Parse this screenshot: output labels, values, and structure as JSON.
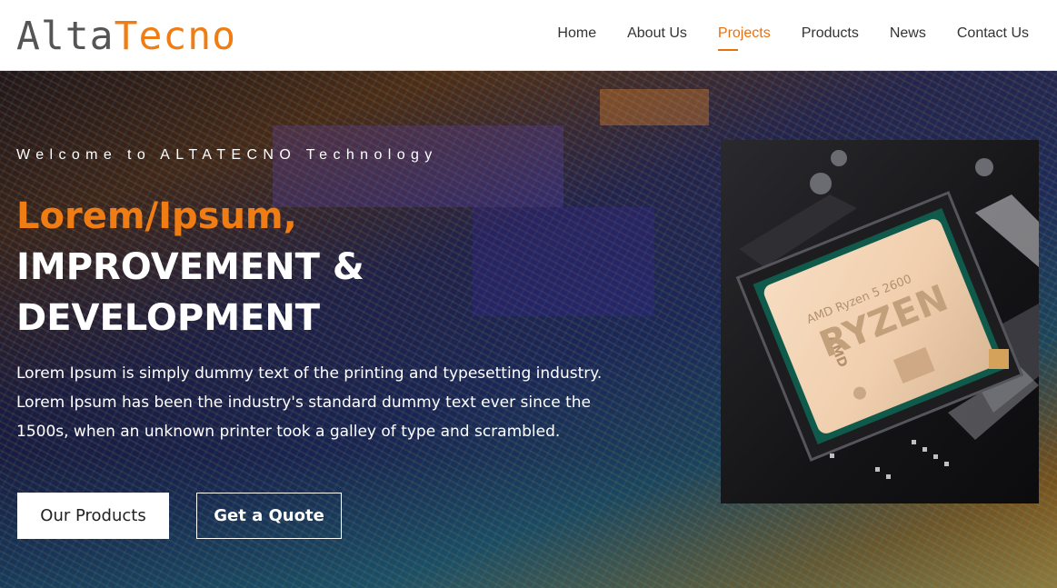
{
  "brand": {
    "part1": "Alta",
    "part2": "Tecno"
  },
  "nav": {
    "items": [
      {
        "label": "Home"
      },
      {
        "label": "About Us"
      },
      {
        "label": "Projects"
      },
      {
        "label": "Products"
      },
      {
        "label": "News"
      },
      {
        "label": "Contact Us"
      }
    ],
    "active": "Projects"
  },
  "hero": {
    "eyebrow": "Welcome to ALTATECNO Technology",
    "headline_accent": "Lorem/Ipsum,",
    "headline_line2": "IMPROVEMENT &",
    "headline_line3": "DEVELOPMENT",
    "description": "Lorem Ipsum is simply dummy text of the printing and typesetting industry. Lorem Ipsum has been the industry's standard dummy text ever since the 1500s, when an unknown printer took a galley of type and scrambled.",
    "primary_button": "Our Products",
    "secondary_button": "Get a Quote"
  },
  "product_image": {
    "chip_brand": "AMD",
    "chip_name": "RYZEN",
    "chip_model": "AMD Ryzen 5 2600"
  },
  "colors": {
    "accent": "#f07d14",
    "logo_gray": "#555555",
    "nav_text": "#333333"
  }
}
